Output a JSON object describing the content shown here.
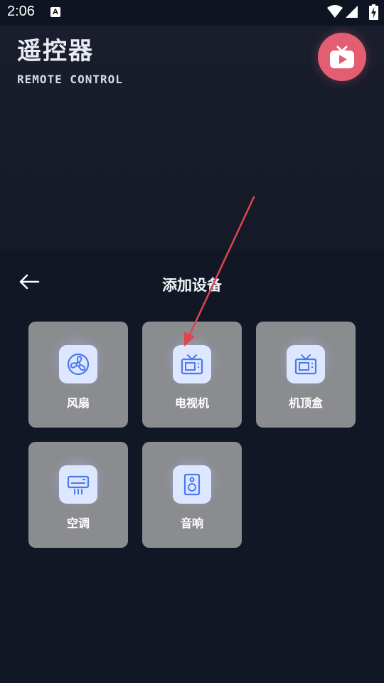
{
  "status_bar": {
    "time": "2:06",
    "notification_icon": "a-icon",
    "right_icons": [
      "wifi-icon",
      "signal-icon",
      "battery-charging-icon"
    ]
  },
  "header": {
    "title": "遥控器",
    "subtitle": "REMOTE CONTROL",
    "video_button_icon": "tv-play-icon",
    "accent_color": "#e35e72"
  },
  "sheet": {
    "back_icon": "arrow-left-icon",
    "title": "添加设备",
    "devices": [
      {
        "label": "风扇",
        "icon": "fan-icon"
      },
      {
        "label": "电视机",
        "icon": "tv-icon"
      },
      {
        "label": "机顶盒",
        "icon": "tv-icon"
      },
      {
        "label": "空调",
        "icon": "air-conditioner-icon"
      },
      {
        "label": "音响",
        "icon": "speaker-icon"
      }
    ]
  },
  "colors": {
    "background": "#0f1422",
    "card": "#8b8c8f",
    "icon_tile": "#dde7ff",
    "icon_stroke": "#4a78f0",
    "annotation_arrow": "#e0454e"
  }
}
